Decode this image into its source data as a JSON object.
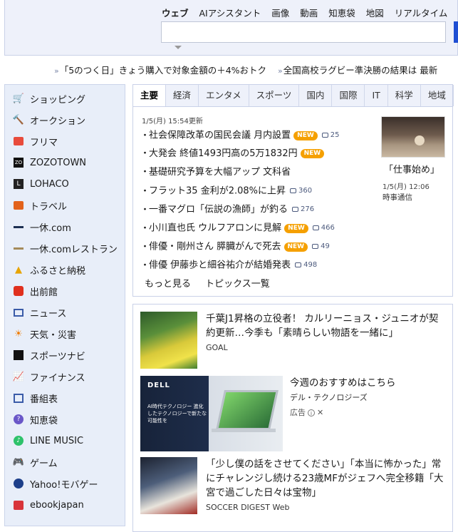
{
  "search": {
    "tabs": [
      "ウェブ",
      "AIアシスタント",
      "画像",
      "動画",
      "知恵袋",
      "地図",
      "リアルタイム"
    ],
    "query": ""
  },
  "ticker": [
    "「5のつく日」きょう購入で対象金額の＋4%おトク",
    "全国高校ラグビー準決勝の結果は 最新"
  ],
  "sidebar": {
    "items": [
      {
        "label": "ショッピング",
        "icon": "shopping-cart-icon"
      },
      {
        "label": "オークション",
        "icon": "auction-hammer-icon"
      },
      {
        "label": "フリマ",
        "icon": "flea-market-icon"
      },
      {
        "label": "ZOZOTOWN",
        "icon": "zozotown-icon"
      },
      {
        "label": "LOHACO",
        "icon": "lohaco-icon"
      },
      {
        "label": "トラベル",
        "icon": "travel-suitcase-icon"
      },
      {
        "label": "一休.com",
        "icon": "ikyu-icon"
      },
      {
        "label": "一休.comレストラン",
        "icon": "ikyu-restaurant-icon"
      },
      {
        "label": "ふるさと納税",
        "icon": "furusato-icon"
      },
      {
        "label": "出前館",
        "icon": "demaecan-icon"
      },
      {
        "label": "ニュース",
        "icon": "news-icon"
      },
      {
        "label": "天気・災害",
        "icon": "weather-icon"
      },
      {
        "label": "スポーツナビ",
        "icon": "sports-icon"
      },
      {
        "label": "ファイナンス",
        "icon": "finance-chart-icon"
      },
      {
        "label": "番組表",
        "icon": "tv-guide-icon"
      },
      {
        "label": "知恵袋",
        "icon": "chiebukuro-icon"
      },
      {
        "label": "LINE MUSIC",
        "icon": "line-music-icon"
      },
      {
        "label": "ゲーム",
        "icon": "gamepad-icon"
      },
      {
        "label": "Yahoo!モバゲー",
        "icon": "mobage-icon"
      },
      {
        "label": "ebookjapan",
        "icon": "ebook-icon"
      }
    ]
  },
  "topics": {
    "tabs": [
      "主要",
      "経済",
      "エンタメ",
      "スポーツ",
      "国内",
      "国際",
      "IT",
      "科学",
      "地域"
    ],
    "updated": "1/5(月) 15:54更新",
    "new_label": "NEW",
    "items": [
      {
        "title": "社会保障改革の国民会議 月内設置",
        "new": true,
        "comments": "25"
      },
      {
        "title": "大発会 終値1493円高の5万1832円",
        "new": true,
        "comments": ""
      },
      {
        "title": "基礎研究予算を大幅アップ 文科省",
        "new": false,
        "comments": ""
      },
      {
        "title": "フラット35 金利が2.08%に上昇",
        "new": false,
        "comments": "360"
      },
      {
        "title": "一番マグロ「伝説の漁師」が釣る",
        "new": false,
        "comments": "276"
      },
      {
        "title": "小川直也氏 ウルフアロンに見解",
        "new": true,
        "comments": "466"
      },
      {
        "title": "俳優・剛州さん 膵臓がんで死去",
        "new": true,
        "comments": "49"
      },
      {
        "title": "俳優 伊藤歩と細谷祐介が結婚発表",
        "new": false,
        "comments": "498"
      }
    ],
    "more": "もっと見る",
    "list": "トピックス一覧",
    "pickup": {
      "title": "「仕事始め」",
      "date": "1/5(月) 12:06",
      "source": "時事通信"
    }
  },
  "feed": {
    "items": [
      {
        "title": "千葉J1昇格の立役者！ カルリーニョス・ジュニオが契約更新…今季も「素晴らしい物語を一緒に」",
        "source": "GOAL"
      },
      {
        "title": "今週のおすすめはこちら",
        "source": "デル・テクノロジーズ",
        "ad_label": "広告",
        "ad_brand": "DELL",
        "ad_copy": "AI時代テクノロジー 進化したテクノロジーで新たな可能性を"
      },
      {
        "title": "「少し僕の話をさせてください」「本当に怖かった」常にチャレンジし続ける23歳MFがジェフへ完全移籍「大宮で過ごした日々は宝物」",
        "source": "SOCCER DIGEST Web"
      }
    ]
  }
}
